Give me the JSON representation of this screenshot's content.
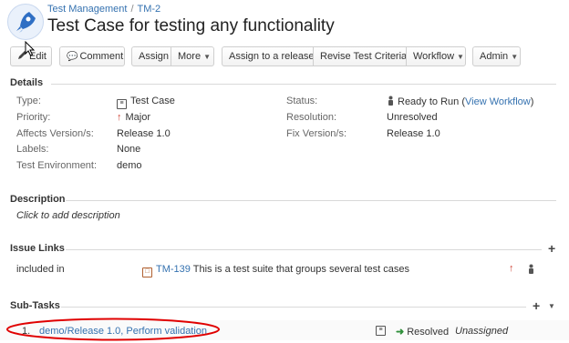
{
  "header": {
    "breadcrumb_project": "Test Management",
    "breadcrumb_sep": "/",
    "breadcrumb_issue": "TM-2",
    "title": "Test Case for testing any functionality"
  },
  "toolbar": {
    "edit": "Edit",
    "comment": "Comment",
    "assign": "Assign",
    "more": "More",
    "assign_release": "Assign to a release",
    "revise": "Revise Test Criteria",
    "workflow": "Workflow",
    "admin": "Admin"
  },
  "details": {
    "heading": "Details",
    "type_label": "Type:",
    "type_value": "Test Case",
    "priority_label": "Priority:",
    "priority_value": "Major",
    "affects_label": "Affects Version/s:",
    "affects_value": "Release 1.0",
    "labels_label": "Labels:",
    "labels_value": "None",
    "env_label": "Test Environment:",
    "env_value": "demo",
    "status_label": "Status:",
    "status_value": "Ready to Run",
    "status_link_open": "(",
    "status_link": "View Workflow",
    "status_link_close": ")",
    "resolution_label": "Resolution:",
    "resolution_value": "Unresolved",
    "fix_label": "Fix Version/s:",
    "fix_value": "Release 1.0"
  },
  "description": {
    "heading": "Description",
    "placeholder": "Click to add description"
  },
  "issue_links": {
    "heading": "Issue Links",
    "relation": "included in",
    "key": "TM-139",
    "summary": "This is a test suite that groups several test cases"
  },
  "subtasks": {
    "heading": "Sub-Tasks",
    "index": "1.",
    "summary": "demo/Release 1.0, Perform validation",
    "status": "Resolved",
    "assignee": "Unassigned"
  },
  "colors": {
    "link": "#3572b0",
    "priority_arrow": "#d04437",
    "highlight_ellipse": "#e00000"
  }
}
